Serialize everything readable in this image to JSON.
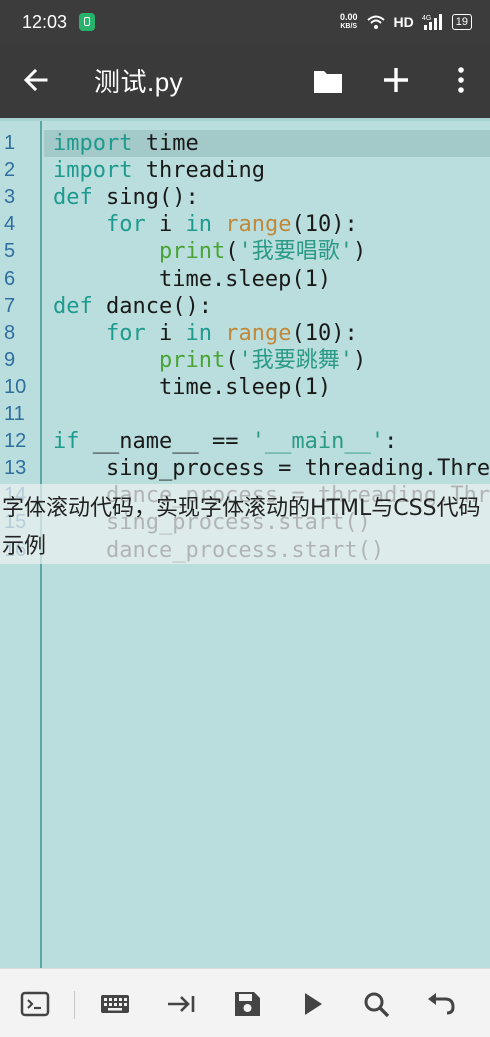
{
  "status_bar": {
    "time": "12:03",
    "speed_value": "0.00",
    "speed_unit": "KB/S",
    "network": "HD",
    "signal_label": "4G",
    "battery": "19"
  },
  "app_bar": {
    "title": "测试.py"
  },
  "editor": {
    "lines": [
      {
        "num": "1",
        "code": "import time"
      },
      {
        "num": "2",
        "code": "import threading"
      },
      {
        "num": "3",
        "code": "def sing():"
      },
      {
        "num": "4",
        "code": "    for i in range(10):"
      },
      {
        "num": "5",
        "code": "        print('我要唱歌')"
      },
      {
        "num": "6",
        "code": "        time.sleep(1)"
      },
      {
        "num": "7",
        "code": "def dance():"
      },
      {
        "num": "8",
        "code": "    for i in range(10):"
      },
      {
        "num": "9",
        "code": "        print('我要跳舞')"
      },
      {
        "num": "10",
        "code": "        time.sleep(1)"
      },
      {
        "num": "11",
        "code": ""
      },
      {
        "num": "12",
        "code": "if __name__ == '__main__':"
      },
      {
        "num": "13",
        "code": "    sing_process = threading.Thre"
      },
      {
        "num": "14",
        "code": "    dance_process = threading.Thr"
      },
      {
        "num": "15",
        "code": "    sing_process.start()"
      },
      {
        "num": "16",
        "code": "    dance_process.start()"
      }
    ]
  },
  "overlay_caption": "字体滚动代码，实现字体滚动的HTML与CSS代码示例",
  "toolbar": {
    "icons": [
      "terminal-icon",
      "keyboard-icon",
      "tab-icon",
      "save-icon",
      "run-icon",
      "search-icon",
      "undo-icon"
    ]
  },
  "colors": {
    "editor_bg": "#b9dedd",
    "app_bar": "#3a3a3a",
    "keyword": "#1f9a8e",
    "builtin": "#c0883a",
    "function_call": "#4aa336"
  }
}
